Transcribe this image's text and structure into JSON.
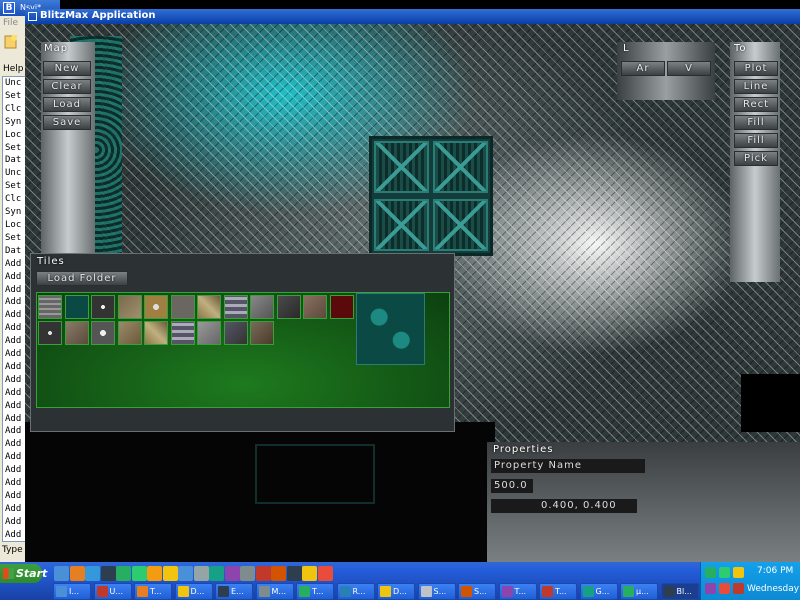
{
  "background_window": {
    "title": "Nsvi*",
    "menu_label": "File",
    "help_label": "Help",
    "log_lines": [
      "Unc",
      "Set",
      "Clc",
      "Syn",
      "Loc",
      "Set",
      "Dat",
      "Unc",
      "Set",
      "Clc",
      "Syn",
      "Loc",
      "Set",
      "Dat",
      "Add",
      "Add",
      "Add",
      "Add",
      "Add",
      "Add",
      "Add",
      "Add",
      "Add",
      "Add",
      "Add",
      "Add",
      "Add",
      "Add",
      "Add",
      "Add",
      "Add",
      "Add",
      "Add",
      "Add",
      "Add",
      "Add"
    ],
    "status_label": "Type"
  },
  "blitzmax": {
    "title": "BlitzMax Application",
    "map_panel": {
      "title": "Map",
      "buttons": [
        "New",
        "Clear",
        "Load",
        "Save"
      ]
    },
    "layer_panel": {
      "title": "L",
      "buttons": [
        "Ar",
        "V"
      ]
    },
    "tools_panel": {
      "title": "To",
      "buttons": [
        "Plot",
        "Line",
        "Rect",
        "Fill",
        "Fill",
        "Pick"
      ]
    },
    "tiles_panel": {
      "title": "Tiles",
      "load_folder_label": "Load Folder"
    },
    "properties_panel": {
      "title": "Properties",
      "property_name_value": "Property Name",
      "value_field": "500.0",
      "vector_value": "0.400, 0.400"
    }
  },
  "taskbar": {
    "start_label": "Start",
    "buttons": [
      {
        "label": "I...",
        "color": "#4a90d9"
      },
      {
        "label": "U...",
        "color": "#c0392b"
      },
      {
        "label": "T...",
        "color": "#e67e22"
      },
      {
        "label": "D...",
        "color": "#f1c40f"
      },
      {
        "label": "E...",
        "color": "#2c3e50"
      },
      {
        "label": "M...",
        "color": "#7f8c8d"
      },
      {
        "label": "T...",
        "color": "#27ae60"
      },
      {
        "label": "R...",
        "color": "#2980b9"
      },
      {
        "label": "D...",
        "color": "#f1c40f"
      },
      {
        "label": "S...",
        "color": "#bdc3c7"
      },
      {
        "label": "S...",
        "color": "#d35400"
      },
      {
        "label": "T...",
        "color": "#8e44ad"
      },
      {
        "label": "T...",
        "color": "#c0392b"
      },
      {
        "label": "G...",
        "color": "#16a085"
      },
      {
        "label": "µ...",
        "color": "#27ae60"
      },
      {
        "label": "Bl...",
        "color": "#2c3e50"
      }
    ],
    "clock": "7:06 PM",
    "day": "Wednesday"
  }
}
